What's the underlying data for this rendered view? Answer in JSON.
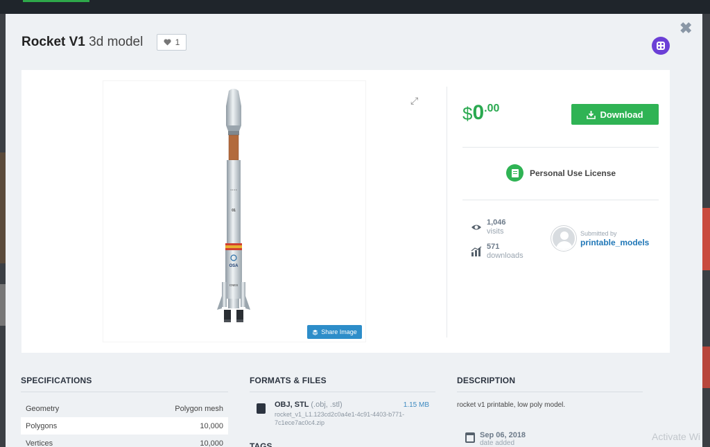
{
  "header": {
    "title_bold": "Rocket V1",
    "title_sub": "3d model",
    "like_count": "1"
  },
  "actions": {
    "close_symbol": "✖",
    "expand_symbol": "⤢",
    "share_label": "Share Image"
  },
  "pricing": {
    "currency": "$",
    "integer": "0",
    "decimal": ".00",
    "download_label": "Download",
    "license_label": "Personal Use License"
  },
  "stats": {
    "visits_count": "1,046",
    "visits_label": "visits",
    "downloads_count": "571",
    "downloads_label": "downloads"
  },
  "submitter": {
    "label": "Submitted by",
    "name": "printable_models"
  },
  "specifications": {
    "heading": "SPECIFICATIONS",
    "rows": [
      {
        "label": "Geometry",
        "value": "Polygon mesh"
      },
      {
        "label": "Polygons",
        "value": "10,000"
      },
      {
        "label": "Vertices",
        "value": "10,000"
      }
    ]
  },
  "formats": {
    "heading": "FORMATS & FILES",
    "file_types": "OBJ, STL",
    "file_ext": "(.obj, .stl)",
    "file_size": "1.15 MB",
    "file_path": "rocket_v1_L1.123cd2c0a4e1-4c91-4403-b771-7c1ece7ac0c4.zip",
    "tags_heading": "TAGS"
  },
  "description": {
    "heading": "DESCRIPTION",
    "text": "rocket v1 printable, low poly model.",
    "date_value": "Sep 06, 2018",
    "date_label": "date added"
  },
  "rocket_labels": {
    "brand": "OSA",
    "stage": "01",
    "bottom": "CNES"
  },
  "watermark": "Activate Wi",
  "colors": {
    "accent_green": "#2fb354",
    "link_blue": "#2077b7",
    "share_blue": "#2d8dc9",
    "dice_purple": "#6b3fd6"
  }
}
